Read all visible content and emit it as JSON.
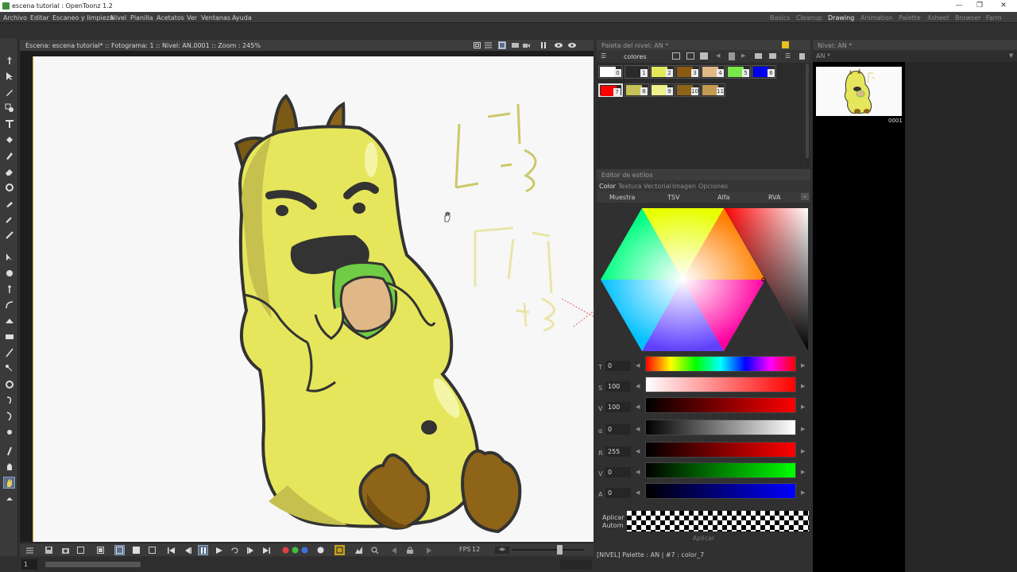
{
  "window": {
    "title": "escena tutorial : OpenToonz 1.2"
  },
  "menu": [
    "Archivo",
    "Editar",
    "Escaneo y limpieza",
    "Nivel",
    "Planilla",
    "Acetatos",
    "Ver",
    "Ventanas",
    "Ayuda"
  ],
  "rooms": [
    "Basics",
    "Cleanup",
    "Drawing",
    "Animation",
    "Palette",
    "Xsheet",
    "Browser",
    "Farm"
  ],
  "active_room": "Drawing",
  "viewer": {
    "info": "Escena: escena tutorial*  ::  Fotograma: 1  ::  Nivel: AN.0001  ::  Zoom : 245%"
  },
  "canvas_drawing": {
    "top_note": {
      "line1": "-T",
      "line2": "-B"
    },
    "bottom_note": {
      "line1": "+T",
      "line2": "+B"
    }
  },
  "bottom": {
    "fps_label": "FPS",
    "fps_value": "12",
    "frame": "1"
  },
  "palette": {
    "title": "Paleta del nivel: AN *",
    "name": "colores",
    "chips": [
      {
        "n": "0",
        "color": "#ffffff"
      },
      {
        "n": "1",
        "color": "#2a2a2a"
      },
      {
        "n": "2",
        "color": "#e2ea5c"
      },
      {
        "n": "3",
        "color": "#8a5a10"
      },
      {
        "n": "4",
        "color": "#e0b888"
      },
      {
        "n": "5",
        "color": "#7ae84a"
      },
      {
        "n": "6",
        "color": "#0000f0"
      },
      {
        "n": "7",
        "color": "#ff0000"
      },
      {
        "n": "8",
        "color": "#c7c158"
      },
      {
        "n": "9",
        "color": "#eef08a"
      },
      {
        "n": "10",
        "color": "#8e6418"
      },
      {
        "n": "11",
        "color": "#c49a50"
      }
    ],
    "selected_chip": "7"
  },
  "style_editor": {
    "title": "Editor de estilos",
    "tabs": [
      "Color",
      "Textura",
      "Vectorial",
      "Imagen",
      "Opciones"
    ],
    "active_tab": "Color",
    "subtabs": [
      "Muestra",
      "TSV",
      "Alfa",
      "RVA"
    ],
    "sliders": [
      {
        "label": "T",
        "value": "0"
      },
      {
        "label": "S",
        "value": "100"
      },
      {
        "label": "V",
        "value": "100"
      },
      {
        "label": "α",
        "value": "0"
      },
      {
        "label": "R",
        "value": "255"
      },
      {
        "label": "V",
        "value": "0"
      },
      {
        "label": "A",
        "value": "0"
      }
    ],
    "apply_auto": "Aplicar\nAutom",
    "apply_button": "Aplicar",
    "current_color": "#ff0000"
  },
  "status": "[NIVEL]  Palette : AN | #7 : color_7",
  "level_strip": {
    "title": "Nivel: AN *",
    "selector": "AN *",
    "frame_label": "0001"
  },
  "icons": [
    "animate-tool-icon",
    "selection-tool-icon",
    "brush-tool-icon",
    "geometric-tool-icon",
    "type-tool-icon",
    "fill-tool-icon",
    "paint-brush-icon",
    "eraser-icon",
    "tape-icon",
    "style-picker-icon",
    "rgb-picker-icon",
    "control-point-editor-icon",
    "pinch-icon",
    "pump-icon",
    "magnet-icon",
    "bender-icon",
    "iron-icon",
    "cutter-icon",
    "skeleton-icon",
    "tracker-icon",
    "hook-icon",
    "plastic-icon",
    "zoom-icon",
    "rotate-icon",
    "hand-icon"
  ]
}
